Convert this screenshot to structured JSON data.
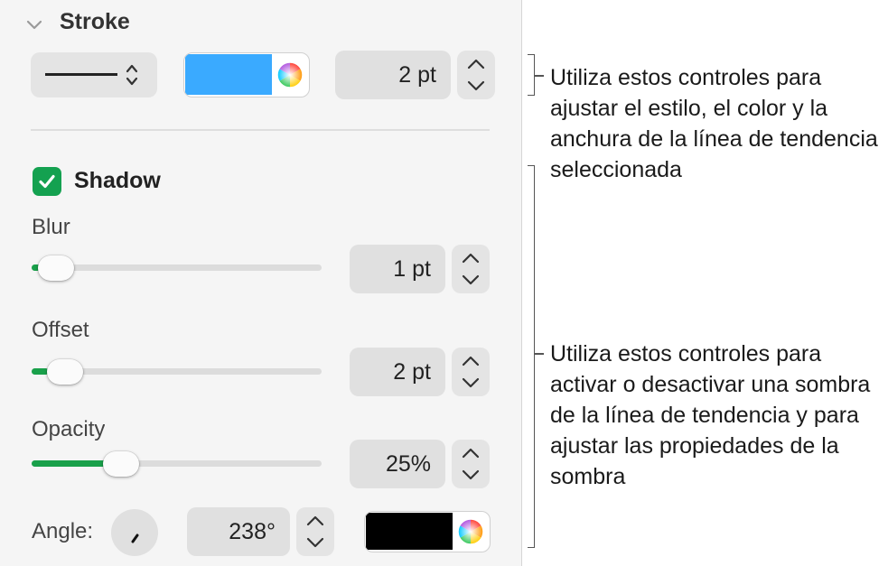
{
  "stroke": {
    "title": "Stroke",
    "width_value": "2 pt",
    "color": "#3aaaff"
  },
  "shadow": {
    "title": "Shadow",
    "checked": true,
    "blur": {
      "label": "Blur",
      "value": "1 pt",
      "level": 0.02
    },
    "offset": {
      "label": "Offset",
      "value": "2 pt",
      "level": 0.05
    },
    "opacity": {
      "label": "Opacity",
      "value": "25%",
      "level": 0.25
    },
    "angle": {
      "label": "Angle:",
      "value": "238°"
    },
    "color": "#000000"
  },
  "annotations": {
    "stroke_note": "Utiliza estos controles para ajustar el estilo, el color y la anchura de la línea de tendencia seleccionada",
    "shadow_note": "Utiliza estos controles para activar o desactivar una sombra de la línea de tendencia y para ajustar las propiedades de la sombra"
  },
  "icons": {
    "disclosure": "chevron-down-icon",
    "line_style": "line-style-icon",
    "color_wheel": "color-wheel-icon",
    "checkbox": "checkmark-icon",
    "stepper": "stepper-arrows-icon",
    "angle_knob": "angle-dial-icon"
  },
  "colors": {
    "accent_green": "#19a04a",
    "panel_bg": "#f5f5f5"
  }
}
